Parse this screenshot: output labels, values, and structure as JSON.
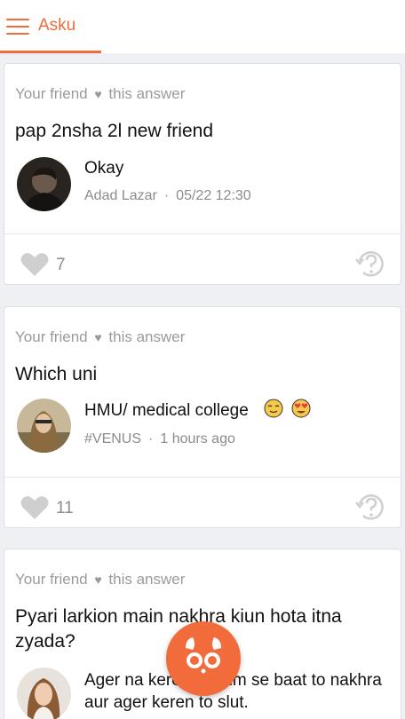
{
  "app": {
    "title": "Asku"
  },
  "colors": {
    "accent": "#f26b3a"
  },
  "cards": [
    {
      "head_prefix": "Your friend",
      "head_suffix": "this answer",
      "question": "pap 2nsha 2l new friend",
      "answer": "Okay",
      "author": "Adad Lazar",
      "time": "05/22 12:30",
      "likes": "7"
    },
    {
      "head_prefix": "Your friend",
      "head_suffix": "this answer",
      "question": "Which uni",
      "answer": "HMU/ medical college",
      "author": "#VENUS",
      "time": "1 hours ago",
      "likes": "11"
    },
    {
      "head_prefix": "Your friend",
      "head_suffix": "this answer",
      "question": "Pyari larkion main nakhra kiun hota itna zyada?",
      "answer": "Ager na keren to hum se baat to nakhra aur ager keren to slut."
    }
  ],
  "icons": {
    "menu": "hamburger-icon",
    "like": "heart-icon",
    "ask": "ask-question-icon",
    "fab": "mascot-icon"
  }
}
